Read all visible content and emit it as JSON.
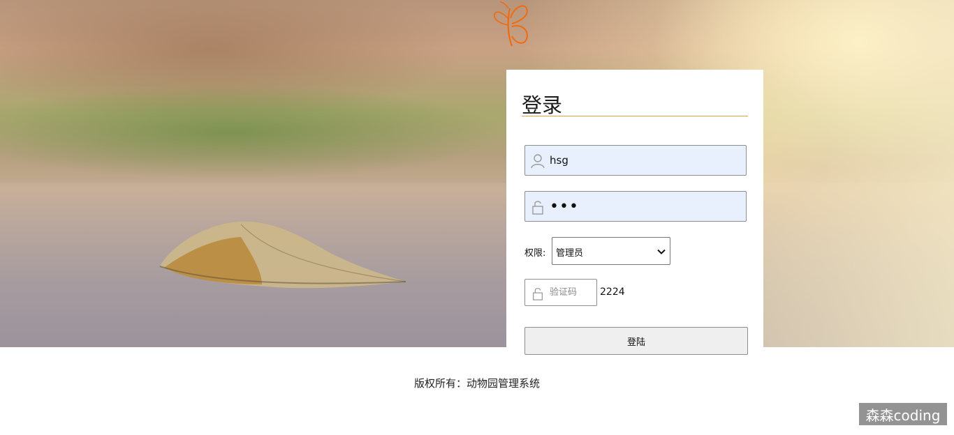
{
  "login_card": {
    "title": "登录",
    "username": {
      "value": "hsg",
      "icon": "user-icon"
    },
    "password": {
      "value": "•••",
      "icon": "lock-icon"
    },
    "role": {
      "label": "权限:",
      "selected": "管理员"
    },
    "captcha": {
      "placeholder": "验证码",
      "code": "2224",
      "icon": "lock-icon"
    },
    "submit_label": "登陆"
  },
  "footer": {
    "copyright": "版权所有：动物园管理系统"
  },
  "watermark": "森森coding",
  "colors": {
    "accent_line": "#d9a441",
    "logo": "#f06a10",
    "input_autofill_bg": "#e8f0fe"
  }
}
